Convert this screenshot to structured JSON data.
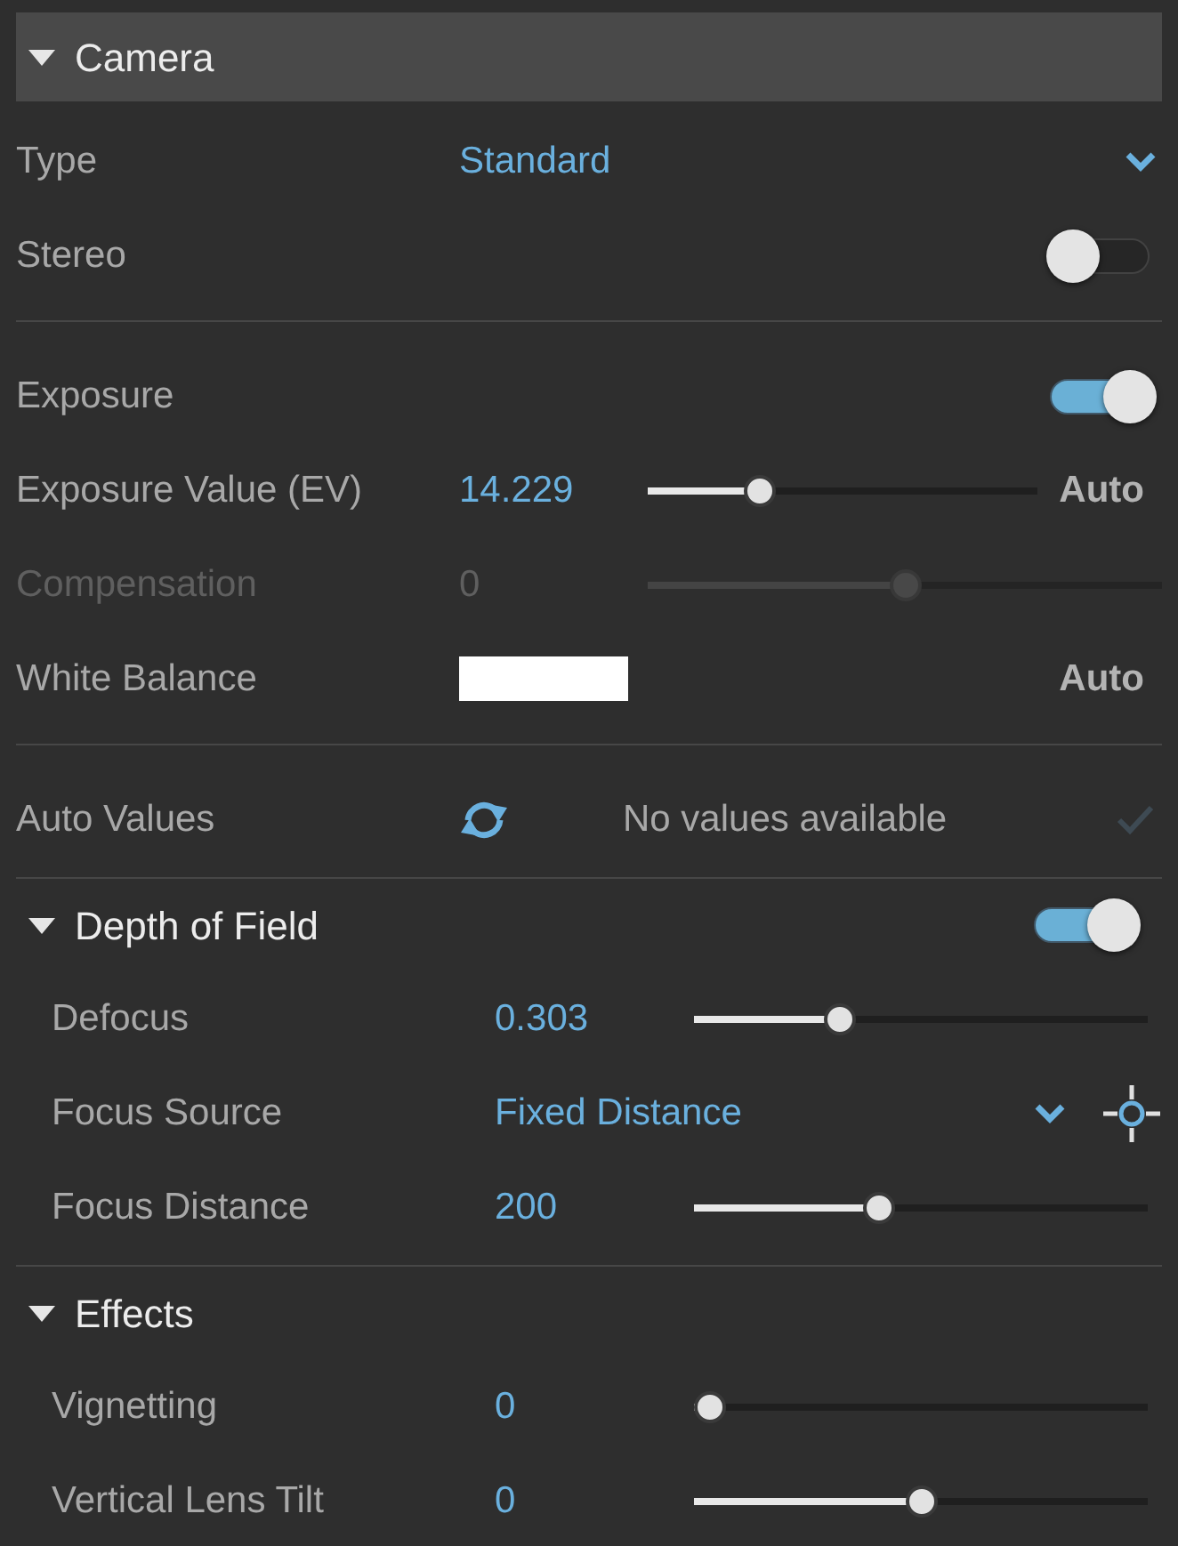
{
  "camera": {
    "title": "Camera",
    "expanded": true,
    "groups": [
      {
        "rows": [
          {
            "kind": "dropdown",
            "label": "Type",
            "value": "Standard"
          },
          {
            "kind": "toggle",
            "label": "Stereo",
            "on": false
          }
        ]
      },
      {
        "rows": [
          {
            "kind": "toggle",
            "label": "Exposure",
            "on": true
          },
          {
            "kind": "slider",
            "label": "Exposure Value (EV)",
            "value": "14.229",
            "level": 0.27,
            "disabled": false,
            "auto": "Auto"
          },
          {
            "kind": "slider",
            "label": "Compensation",
            "value": "0",
            "level": 0.5,
            "disabled": true
          },
          {
            "kind": "swatch",
            "label": "White Balance",
            "color": "#ffffff",
            "auto": "Auto"
          }
        ]
      },
      {
        "rows": [
          {
            "kind": "refresh",
            "label": "Auto Values",
            "message": "No values available",
            "apply_enabled": false
          }
        ]
      }
    ]
  },
  "sections": [
    {
      "title": "Depth of Field",
      "expanded": true,
      "on": true,
      "rows": [
        {
          "kind": "slider",
          "label": "Defocus",
          "value": "0.303",
          "level": 0.31,
          "disabled": false
        },
        {
          "kind": "picker",
          "label": "Focus Source",
          "value": "Fixed Distance"
        },
        {
          "kind": "slider",
          "label": "Focus Distance",
          "value": "200",
          "level": 0.4,
          "disabled": false
        }
      ]
    },
    {
      "title": "Effects",
      "expanded": true,
      "rows": [
        {
          "kind": "slider",
          "label": "Vignetting",
          "value": "0",
          "level": 0,
          "disabled": false
        },
        {
          "kind": "slider",
          "label": "Vertical Lens Tilt",
          "value": "0",
          "level": 0.5,
          "disabled": false
        }
      ]
    }
  ]
}
